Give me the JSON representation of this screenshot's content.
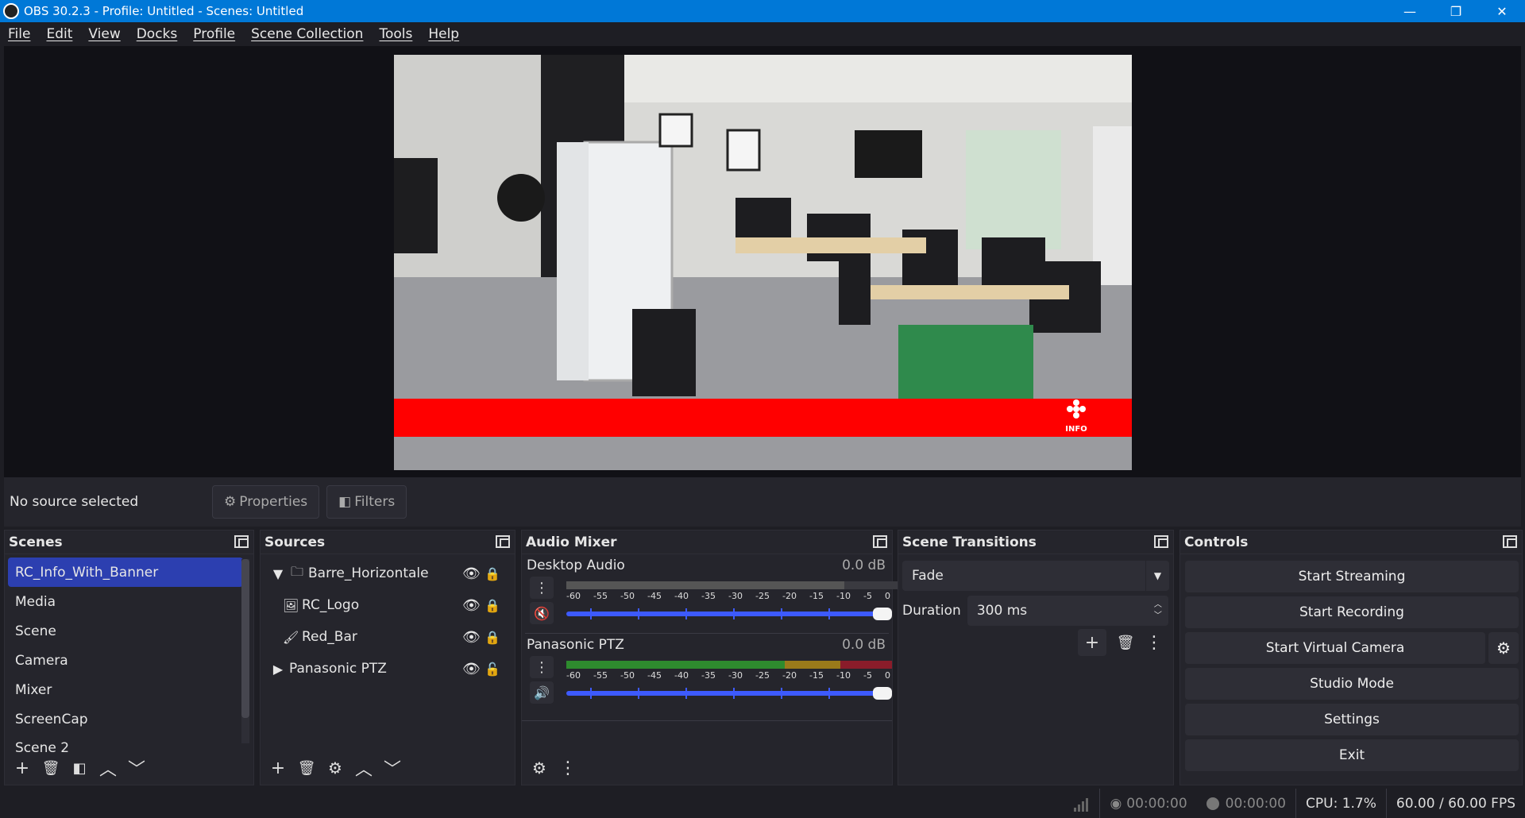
{
  "window": {
    "title": "OBS 30.2.3 - Profile: Untitled - Scenes: Untitled",
    "minimize": "—",
    "maximize": "❐",
    "close": "✕"
  },
  "menu": [
    "File",
    "Edit",
    "View",
    "Docks",
    "Profile",
    "Scene Collection",
    "Tools",
    "Help"
  ],
  "preview": {
    "banner_logo_text": "INFO",
    "banner_color": "#ff0000"
  },
  "source_bar": {
    "status": "No source selected",
    "properties": "Properties",
    "filters": "Filters"
  },
  "scenes": {
    "title": "Scenes",
    "items": [
      "RC_Info_With_Banner",
      "Media",
      "Scene",
      "Camera",
      "Mixer",
      "ScreenCap",
      "Scene 2"
    ],
    "active_index": 0
  },
  "sources": {
    "title": "Sources",
    "items": [
      {
        "name": "Barre_Horizontale",
        "icon": "folder-icon",
        "expander": "▼"
      },
      {
        "name": "RC_Logo",
        "icon": "image-icon"
      },
      {
        "name": "Red_Bar",
        "icon": "color-source-icon"
      },
      {
        "name": "Panasonic PTZ",
        "icon": "play-icon",
        "expander": "▶"
      }
    ]
  },
  "audio_mixer": {
    "title": "Audio Mixer",
    "ticks": [
      "-60",
      "-55",
      "-50",
      "-45",
      "-40",
      "-35",
      "-30",
      "-25",
      "-20",
      "-15",
      "-10",
      "-5",
      "0"
    ],
    "channels": [
      {
        "name": "Desktop Audio",
        "db": "0.0 dB",
        "muted": true,
        "volume": 1.0
      },
      {
        "name": "Panasonic PTZ",
        "db": "0.0 dB",
        "muted": false,
        "volume": 1.0
      }
    ]
  },
  "transitions": {
    "title": "Scene Transitions",
    "selected": "Fade",
    "duration_label": "Duration",
    "duration_value": "300 ms"
  },
  "controls": {
    "title": "Controls",
    "start_streaming": "Start Streaming",
    "start_recording": "Start Recording",
    "start_virtual_camera": "Start Virtual Camera",
    "studio_mode": "Studio Mode",
    "settings": "Settings",
    "exit": "Exit"
  },
  "status": {
    "stream_time": "00:00:00",
    "record_time": "00:00:00",
    "cpu": "CPU: 1.7%",
    "fps": "60.00 / 60.00 FPS"
  },
  "colors": {
    "titlebar": "#0078d7",
    "selected_scene": "#2c3fb0",
    "volume_slider": "#3d5afe",
    "meter_green": "#2e8b2e",
    "meter_yellow": "#9a7a1a",
    "meter_red": "#8a1c2a"
  }
}
